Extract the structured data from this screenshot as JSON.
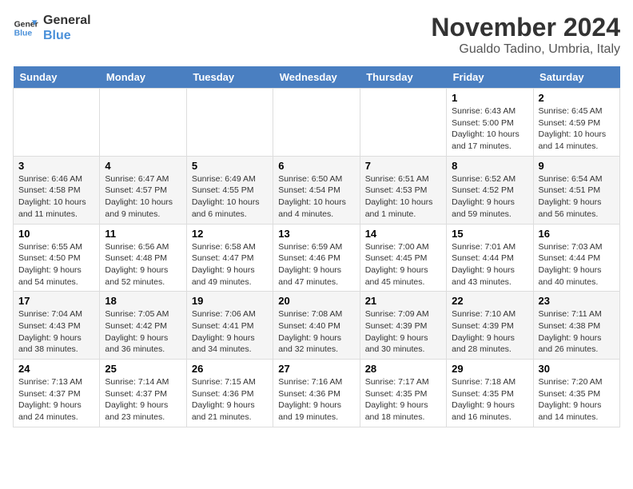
{
  "logo": {
    "line1": "General",
    "line2": "Blue"
  },
  "title": "November 2024",
  "location": "Gualdo Tadino, Umbria, Italy",
  "days_of_week": [
    "Sunday",
    "Monday",
    "Tuesday",
    "Wednesday",
    "Thursday",
    "Friday",
    "Saturday"
  ],
  "weeks": [
    [
      {
        "day": "",
        "info": ""
      },
      {
        "day": "",
        "info": ""
      },
      {
        "day": "",
        "info": ""
      },
      {
        "day": "",
        "info": ""
      },
      {
        "day": "",
        "info": ""
      },
      {
        "day": "1",
        "info": "Sunrise: 6:43 AM\nSunset: 5:00 PM\nDaylight: 10 hours and 17 minutes."
      },
      {
        "day": "2",
        "info": "Sunrise: 6:45 AM\nSunset: 4:59 PM\nDaylight: 10 hours and 14 minutes."
      }
    ],
    [
      {
        "day": "3",
        "info": "Sunrise: 6:46 AM\nSunset: 4:58 PM\nDaylight: 10 hours and 11 minutes."
      },
      {
        "day": "4",
        "info": "Sunrise: 6:47 AM\nSunset: 4:57 PM\nDaylight: 10 hours and 9 minutes."
      },
      {
        "day": "5",
        "info": "Sunrise: 6:49 AM\nSunset: 4:55 PM\nDaylight: 10 hours and 6 minutes."
      },
      {
        "day": "6",
        "info": "Sunrise: 6:50 AM\nSunset: 4:54 PM\nDaylight: 10 hours and 4 minutes."
      },
      {
        "day": "7",
        "info": "Sunrise: 6:51 AM\nSunset: 4:53 PM\nDaylight: 10 hours and 1 minute."
      },
      {
        "day": "8",
        "info": "Sunrise: 6:52 AM\nSunset: 4:52 PM\nDaylight: 9 hours and 59 minutes."
      },
      {
        "day": "9",
        "info": "Sunrise: 6:54 AM\nSunset: 4:51 PM\nDaylight: 9 hours and 56 minutes."
      }
    ],
    [
      {
        "day": "10",
        "info": "Sunrise: 6:55 AM\nSunset: 4:50 PM\nDaylight: 9 hours and 54 minutes."
      },
      {
        "day": "11",
        "info": "Sunrise: 6:56 AM\nSunset: 4:48 PM\nDaylight: 9 hours and 52 minutes."
      },
      {
        "day": "12",
        "info": "Sunrise: 6:58 AM\nSunset: 4:47 PM\nDaylight: 9 hours and 49 minutes."
      },
      {
        "day": "13",
        "info": "Sunrise: 6:59 AM\nSunset: 4:46 PM\nDaylight: 9 hours and 47 minutes."
      },
      {
        "day": "14",
        "info": "Sunrise: 7:00 AM\nSunset: 4:45 PM\nDaylight: 9 hours and 45 minutes."
      },
      {
        "day": "15",
        "info": "Sunrise: 7:01 AM\nSunset: 4:44 PM\nDaylight: 9 hours and 43 minutes."
      },
      {
        "day": "16",
        "info": "Sunrise: 7:03 AM\nSunset: 4:44 PM\nDaylight: 9 hours and 40 minutes."
      }
    ],
    [
      {
        "day": "17",
        "info": "Sunrise: 7:04 AM\nSunset: 4:43 PM\nDaylight: 9 hours and 38 minutes."
      },
      {
        "day": "18",
        "info": "Sunrise: 7:05 AM\nSunset: 4:42 PM\nDaylight: 9 hours and 36 minutes."
      },
      {
        "day": "19",
        "info": "Sunrise: 7:06 AM\nSunset: 4:41 PM\nDaylight: 9 hours and 34 minutes."
      },
      {
        "day": "20",
        "info": "Sunrise: 7:08 AM\nSunset: 4:40 PM\nDaylight: 9 hours and 32 minutes."
      },
      {
        "day": "21",
        "info": "Sunrise: 7:09 AM\nSunset: 4:39 PM\nDaylight: 9 hours and 30 minutes."
      },
      {
        "day": "22",
        "info": "Sunrise: 7:10 AM\nSunset: 4:39 PM\nDaylight: 9 hours and 28 minutes."
      },
      {
        "day": "23",
        "info": "Sunrise: 7:11 AM\nSunset: 4:38 PM\nDaylight: 9 hours and 26 minutes."
      }
    ],
    [
      {
        "day": "24",
        "info": "Sunrise: 7:13 AM\nSunset: 4:37 PM\nDaylight: 9 hours and 24 minutes."
      },
      {
        "day": "25",
        "info": "Sunrise: 7:14 AM\nSunset: 4:37 PM\nDaylight: 9 hours and 23 minutes."
      },
      {
        "day": "26",
        "info": "Sunrise: 7:15 AM\nSunset: 4:36 PM\nDaylight: 9 hours and 21 minutes."
      },
      {
        "day": "27",
        "info": "Sunrise: 7:16 AM\nSunset: 4:36 PM\nDaylight: 9 hours and 19 minutes."
      },
      {
        "day": "28",
        "info": "Sunrise: 7:17 AM\nSunset: 4:35 PM\nDaylight: 9 hours and 18 minutes."
      },
      {
        "day": "29",
        "info": "Sunrise: 7:18 AM\nSunset: 4:35 PM\nDaylight: 9 hours and 16 minutes."
      },
      {
        "day": "30",
        "info": "Sunrise: 7:20 AM\nSunset: 4:35 PM\nDaylight: 9 hours and 14 minutes."
      }
    ]
  ]
}
